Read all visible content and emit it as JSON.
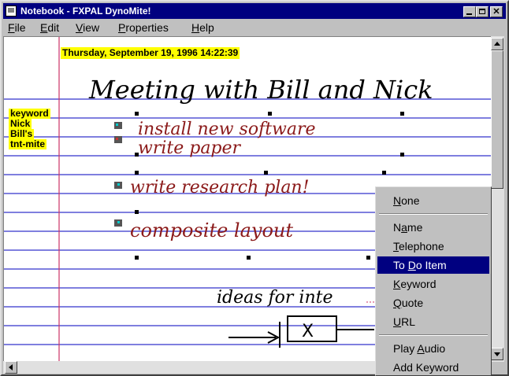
{
  "window": {
    "title": "Notebook - FXPAL DynoMite!"
  },
  "menu": {
    "items": [
      {
        "label": "File",
        "accel": "F",
        "rest": "ile"
      },
      {
        "label": "Edit",
        "accel": "E",
        "rest": "dit"
      },
      {
        "label": "View",
        "accel": "V",
        "rest": "iew"
      },
      {
        "label": "Properties",
        "accel": "P",
        "rest": "roperties"
      },
      {
        "label": "Help",
        "accel": "H",
        "rest": "elp"
      }
    ]
  },
  "page": {
    "date_stamp": "Thursday, September 19, 1996 14:22:39",
    "keywords": [
      "keyword",
      "Nick",
      "Bill's",
      "tnt-mite"
    ]
  },
  "ink": {
    "line1": "Meeting with Bill and Nick",
    "line2": "install new software",
    "line3": "write paper",
    "line4": "write research plan!",
    "line5": "composite layout",
    "line6": "ideas for inte",
    "sketch_box": "X"
  },
  "context_menu": {
    "selected": "To Do Item",
    "items": [
      {
        "label": "None",
        "accel": "N",
        "pre": "",
        "rest": "one"
      },
      {
        "label": "Name",
        "accel": "a",
        "pre": "N",
        "rest": "me"
      },
      {
        "label": "Telephone",
        "accel": "T",
        "pre": "",
        "rest": "elephone"
      },
      {
        "label": "To Do Item",
        "accel": "D",
        "pre": "To ",
        "rest": "o Item"
      },
      {
        "label": "Keyword",
        "accel": "K",
        "pre": "",
        "rest": "eyword"
      },
      {
        "label": "Quote",
        "accel": "Q",
        "pre": "",
        "rest": "uote"
      },
      {
        "label": "URL",
        "accel": "U",
        "pre": "",
        "rest": "RL"
      },
      {
        "label": "Play Audio",
        "accel": "A",
        "pre": "Play ",
        "rest": "udio"
      },
      {
        "label": "Add Keyword",
        "accel": "",
        "pre": "Add Keyword",
        "rest": ""
      }
    ]
  },
  "colors": {
    "title_bar": "#000080",
    "rule_lines": "#3333cc",
    "margin_line": "#cc3366",
    "highlight": "#ffff00",
    "ink_black": "#000000",
    "ink_red": "#8b1a1a",
    "selection": "#000080"
  }
}
